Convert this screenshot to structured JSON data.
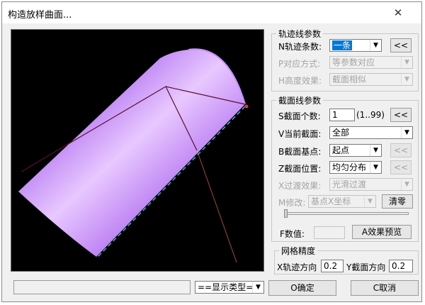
{
  "window": {
    "title": "构造放样曲面...",
    "close_glyph": "✕"
  },
  "trajectory_group": {
    "title": "轨迹线参数",
    "count_label": "N轨迹条数:",
    "count_value": "一条",
    "count_button": "<<",
    "mode_label": "P对应方式:",
    "mode_value": "等参数对应",
    "height_label": "H高度效果:",
    "height_value": "截面相似"
  },
  "section_group": {
    "title": "截面线参数",
    "count_label": "S截面个数:",
    "count_value": "1",
    "count_range": "(1..99)",
    "count_button": "<<",
    "current_label": "V当前截面:",
    "current_value": "全部",
    "basepoint_label": "B截面基点:",
    "basepoint_value": "起点",
    "basepoint_button": "<<",
    "position_label": "Z截面位置:",
    "position_value": "均匀分布",
    "position_button": "<<",
    "transition_label": "X过渡效果:",
    "transition_value": "光滑过渡",
    "modify_label": "M修改:",
    "modify_value": "基点X坐标",
    "clear_button": "清零",
    "numeric_label": "F数值:",
    "preview_button": "A效果预览"
  },
  "grid_group": {
    "title": "网格精度",
    "traj_dir_label": "X轨迹方向",
    "traj_dir_value": "0.2",
    "section_dir_label": "Y截面方向",
    "section_dir_value": "0.2"
  },
  "bottom": {
    "display_type": "==显示类型==",
    "ok_button": "O确定",
    "cancel_button": "C取消"
  },
  "colors": {
    "surface": "#b070f0",
    "surface_highlight": "#e8c8ff",
    "viewport_bg": "#000000",
    "selection": "#0078d7",
    "trajectory_line": "#c03030",
    "section_line": "#30c0d0"
  }
}
